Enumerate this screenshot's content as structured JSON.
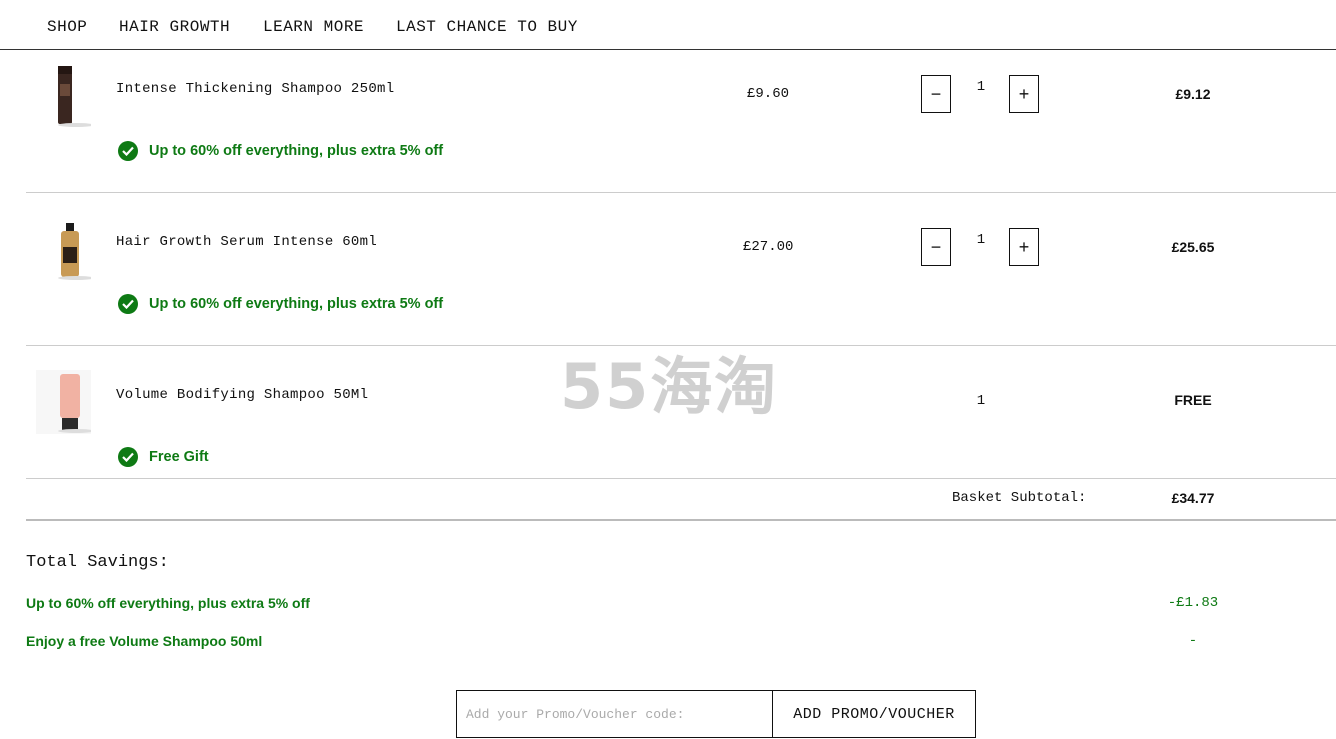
{
  "nav": [
    "SHOP",
    "HAIR GROWTH",
    "LEARN MORE",
    "LAST CHANCE TO BUY"
  ],
  "items": [
    {
      "name": "Intense Thickening Shampoo 250ml",
      "price": "£9.60",
      "qty": "1",
      "total": "£9.12",
      "promo": "Up to 60% off everything, plus extra 5% off"
    },
    {
      "name": "Hair Growth Serum Intense 60ml",
      "price": "£27.00",
      "qty": "1",
      "total": "£25.65",
      "promo": "Up to 60% off everything, plus extra 5% off"
    },
    {
      "name": "Volume Bodifying Shampoo 50Ml",
      "price": "",
      "qty": "1",
      "total": "FREE",
      "promo": "Free Gift"
    }
  ],
  "basket": {
    "subtotal_label": "Basket Subtotal:",
    "subtotal": "£34.77"
  },
  "savings": {
    "title": "Total Savings:",
    "rows": [
      {
        "label": "Up to 60% off everything, plus extra 5% off",
        "value": "-£1.83"
      },
      {
        "label": "Enjoy a free Volume Shampoo 50ml",
        "value": "-"
      }
    ]
  },
  "voucher": {
    "placeholder": "Add your Promo/Voucher code:",
    "button": "ADD PROMO/VOUCHER"
  },
  "watermark": "55海淘",
  "colors": {
    "promo_green": "#0e7a14",
    "border": "#111111",
    "divider": "#cccccc"
  },
  "icons": {
    "decrease": "minus-icon",
    "increase": "plus-icon",
    "promo": "check-circle-icon"
  }
}
